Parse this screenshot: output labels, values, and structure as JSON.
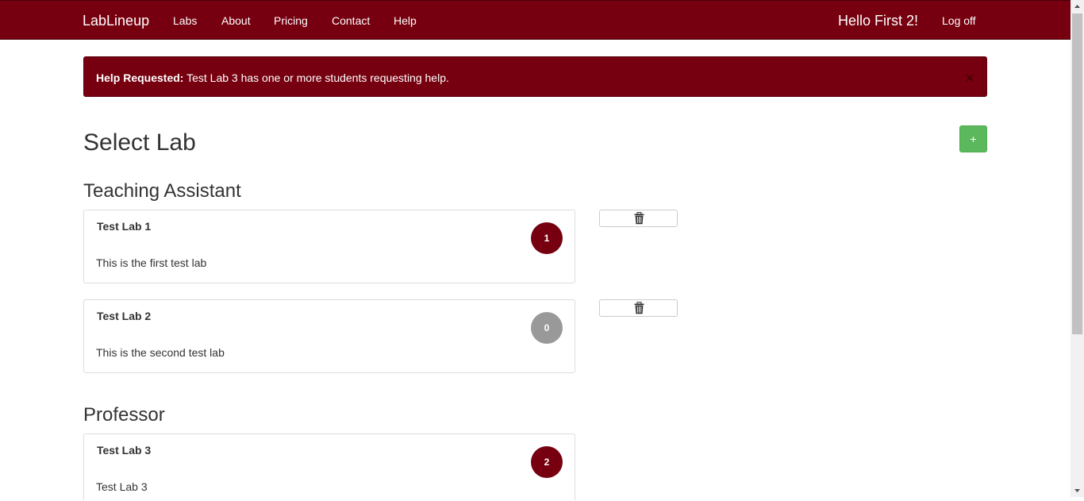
{
  "navbar": {
    "brand": "LabLineup",
    "links": [
      "Labs",
      "About",
      "Pricing",
      "Contact",
      "Help"
    ],
    "greeting": "Hello First 2!",
    "logoff": "Log off",
    "bg_color": "#76000f"
  },
  "alert": {
    "title": "Help Requested:",
    "message": " Test Lab 3 has one or more students requesting help.",
    "close_icon": "close-icon"
  },
  "page": {
    "title": "Select Lab",
    "add_label": "+"
  },
  "sections": [
    {
      "title": "Teaching Assistant",
      "labs": [
        {
          "name": "Test Lab 1",
          "description": "This is the first test lab",
          "count": "1"
        },
        {
          "name": "Test Lab 2",
          "description": "This is the second test lab",
          "count": "0"
        }
      ]
    },
    {
      "title": "Professor",
      "labs": [
        {
          "name": "Test Lab 3",
          "description": "Test Lab 3",
          "count": "2"
        }
      ]
    }
  ],
  "icons": {
    "delete": "trash-icon",
    "add": "plus-icon"
  },
  "colors": {
    "accent": "#76000f",
    "add_button": "#5cb85c",
    "zero_badge": "#999999"
  }
}
